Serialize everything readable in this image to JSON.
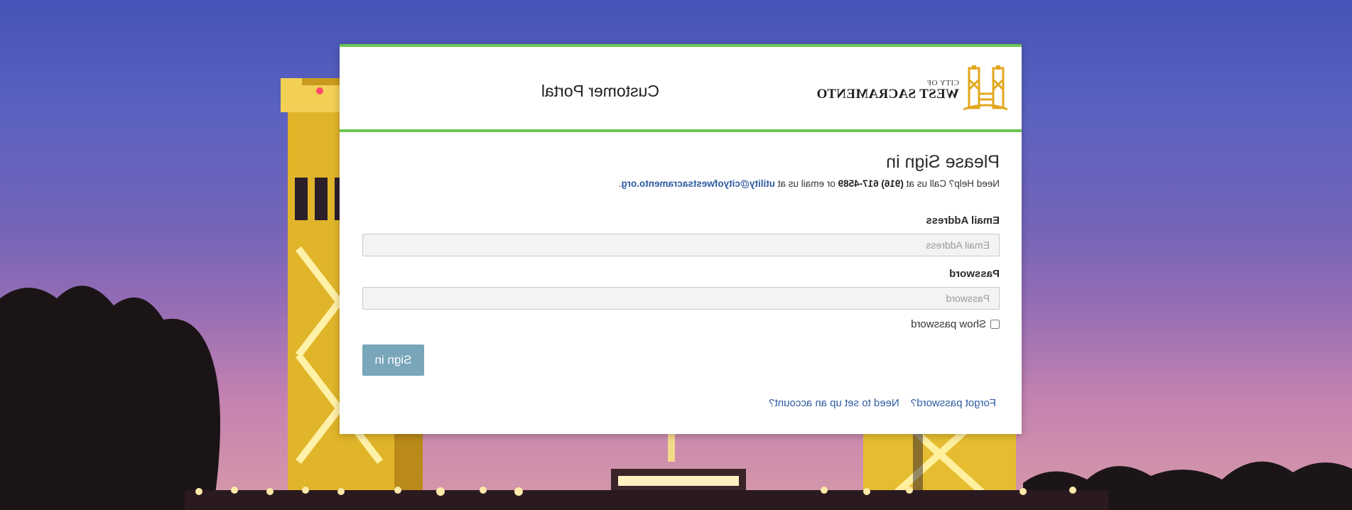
{
  "header": {
    "logo_city": "CITY OF",
    "logo_name": "WEST SACRAMENTO",
    "portal_title": "Customer Portal"
  },
  "signin": {
    "heading": "Please Sign in",
    "help_prefix": "Need Help? Call us at",
    "help_phone": "(916) 617-4589",
    "help_middle": "or email us at",
    "help_email": "utility@cityofwestsacramento.org",
    "help_suffix": "."
  },
  "form": {
    "email_label": "Email Address",
    "email_placeholder": "Email Address",
    "email_value": "",
    "password_label": "Password",
    "password_placeholder": "Password",
    "password_value": "",
    "show_password_label": "Show password",
    "show_password_checked": false,
    "submit_label": "Sign in"
  },
  "links": {
    "forgot_password": "Forgot password?",
    "setup_account": "Need to set up an account?"
  },
  "colors": {
    "accent_green": "#6cc550",
    "button_blue": "#79a6b9",
    "link_blue": "#2d5aa0"
  },
  "display": {
    "mirrored_horizontally": true
  }
}
